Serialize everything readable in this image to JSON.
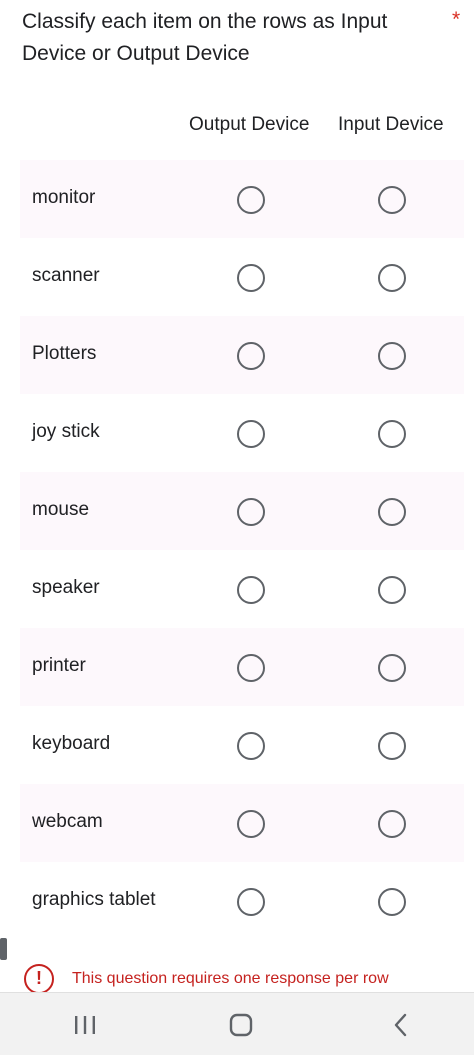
{
  "question": {
    "title": "Classify each item on the rows as Input Device or Output Device",
    "required_marker": "*"
  },
  "columns": {
    "output": "Output Device",
    "input": "Input Device"
  },
  "rows": [
    {
      "label": "monitor"
    },
    {
      "label": "scanner"
    },
    {
      "label": "Plotters"
    },
    {
      "label": "joy stick"
    },
    {
      "label": "mouse"
    },
    {
      "label": "speaker"
    },
    {
      "label": "printer"
    },
    {
      "label": "keyboard"
    },
    {
      "label": "webcam"
    },
    {
      "label": "graphics tablet"
    }
  ],
  "error": {
    "icon": "alert-circle-icon",
    "glyph": "!",
    "message": "This question requires one response per row"
  },
  "navbar": {
    "recent_icon": "recent-apps-icon",
    "home_icon": "home-icon",
    "back_icon": "back-icon"
  },
  "colors": {
    "error": "#c5221f",
    "required": "#d93025",
    "row_shade": "#fdf8fc",
    "radio_border": "#5f6368"
  }
}
